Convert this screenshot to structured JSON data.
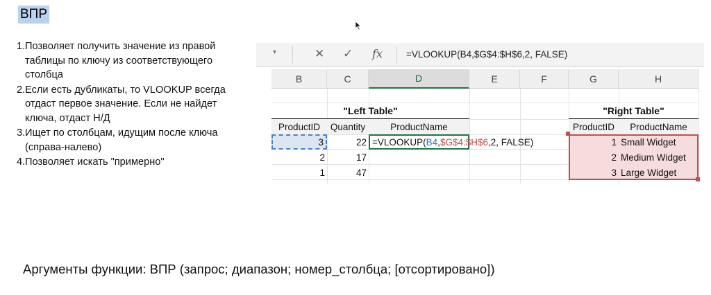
{
  "title": "ВПР",
  "notes": [
    {
      "num": "1.",
      "text": "Позволяет получить значение из правой таблицы по ключу из соответствующего столбца"
    },
    {
      "num": "2.",
      "text": "Если есть дубликаты, то VLOOKUP всегда отдаст первое значение. Если не найдет ключа, отдаст Н/Д"
    },
    {
      "num": "3.",
      "text": "Ищет по столбцам, идущим после ключа (справа-налево)"
    },
    {
      "num": "4.",
      "text": "Позволяет искать \"примерно\""
    }
  ],
  "formula_bar": {
    "formula": "=VLOOKUP(B4,$G$4:$H$6,2, FALSE)",
    "fx_label": "fx"
  },
  "columns": [
    "B",
    "C",
    "D",
    "E",
    "F",
    "G",
    "H"
  ],
  "left_table": {
    "title": "\"Left Table\"",
    "headers": [
      "ProductID",
      "Quantity",
      "ProductName"
    ],
    "rows": [
      {
        "id": "3",
        "qty": "22"
      },
      {
        "id": "2",
        "qty": "17"
      },
      {
        "id": "1",
        "qty": "47"
      }
    ],
    "editing_cell": {
      "eq": "=VLOOKUP(",
      "arg1": "B4",
      "comma1": ",",
      "arg2": "$G$4:$H$6",
      "rest": ",2, FALSE)"
    }
  },
  "right_table": {
    "title": "\"Right Table\"",
    "headers": [
      "ProductID",
      "ProductName"
    ],
    "rows": [
      {
        "id": "1",
        "name": "Small Widget"
      },
      {
        "id": "2",
        "name": "Medium Widget"
      },
      {
        "id": "3",
        "name": "Large Widget"
      }
    ]
  },
  "bottom_text": "Аргументы функции: ВПР (запрос; диапазон; номер_столбца; [отсортировано])",
  "colors": {
    "accent_green": "#217346",
    "ref_blue": "#2e75b6",
    "ref_red": "#c0504d",
    "title_highlight": "#b9d3ee"
  }
}
